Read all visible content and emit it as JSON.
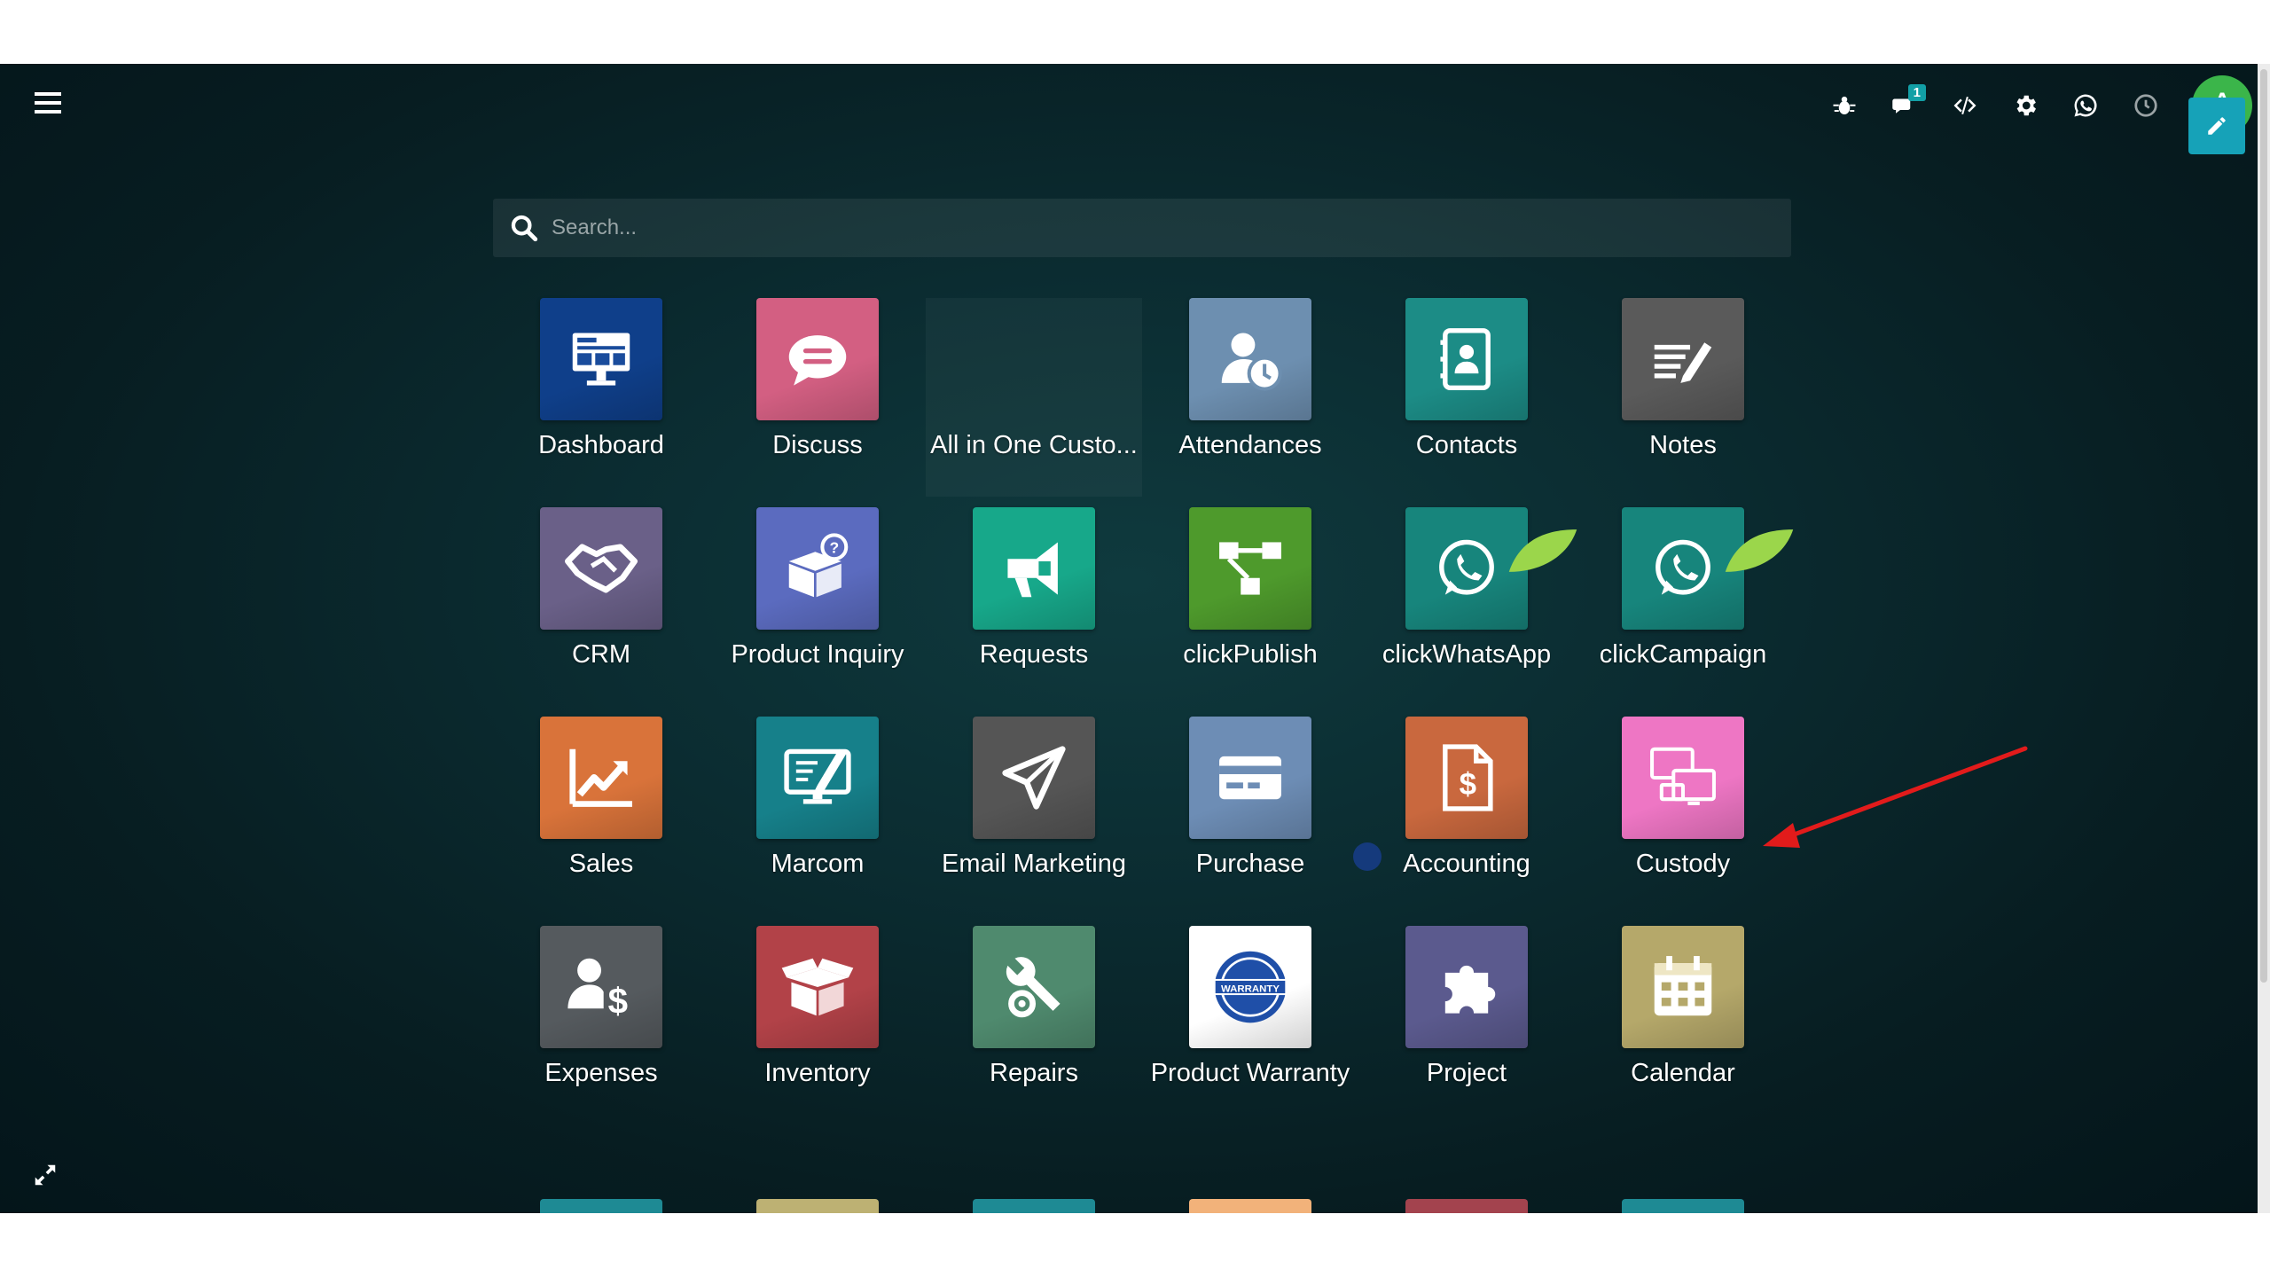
{
  "topbar": {
    "chat_badge": "1",
    "avatar_letter": "A"
  },
  "search": {
    "placeholder": "Search..."
  },
  "apps": [
    {
      "label": "Dashboard",
      "icon": "dashboard-icon",
      "color": "#0f3f8a"
    },
    {
      "label": "Discuss",
      "icon": "chat-bubble-icon",
      "color": "#d35f82"
    },
    {
      "label": "All in One Custo...",
      "icon": "",
      "color": ""
    },
    {
      "label": "Attendances",
      "icon": "user-clock-icon",
      "color": "#6d8fb0"
    },
    {
      "label": "Contacts",
      "icon": "address-book-icon",
      "color": "#1c8c86"
    },
    {
      "label": "Notes",
      "icon": "notes-pencil-icon",
      "color": "#5a5a5a"
    },
    {
      "label": "CRM",
      "icon": "handshake-icon",
      "color": "#6a6088"
    },
    {
      "label": "Product Inquiry",
      "icon": "box-question-icon",
      "color": "#5b6bbf"
    },
    {
      "label": "Requests",
      "icon": "megaphone-icon",
      "color": "#17a88a"
    },
    {
      "label": "clickPublish",
      "icon": "flow-nodes-icon",
      "color": "#4e9a2c"
    },
    {
      "label": "clickWhatsApp",
      "icon": "whatsapp-icon",
      "color": "#17857c"
    },
    {
      "label": "clickCampaign",
      "icon": "whatsapp-icon",
      "color": "#17857c"
    },
    {
      "label": "Sales",
      "icon": "trend-chart-icon",
      "color": "#d9733a"
    },
    {
      "label": "Marcom",
      "icon": "monitor-edit-icon",
      "color": "#16808a"
    },
    {
      "label": "Email Marketing",
      "icon": "paper-plane-icon",
      "color": "#555555"
    },
    {
      "label": "Purchase",
      "icon": "credit-card-icon",
      "color": "#6d8db5"
    },
    {
      "label": "Accounting",
      "icon": "invoice-dollar-icon",
      "color": "#c9683e"
    },
    {
      "label": "Custody",
      "icon": "devices-icon",
      "color": "#ee76c4"
    },
    {
      "label": "Expenses",
      "icon": "user-dollar-icon",
      "color": "#555a5e"
    },
    {
      "label": "Inventory",
      "icon": "open-box-icon",
      "color": "#b24248"
    },
    {
      "label": "Repairs",
      "icon": "wrench-gear-icon",
      "color": "#4f8a6e"
    },
    {
      "label": "Product Warranty",
      "icon": "warranty-seal-icon",
      "color": "#ffffff",
      "seal_text": "WARRANTY"
    },
    {
      "label": "Project",
      "icon": "puzzle-icon",
      "color": "#5b5a8e"
    },
    {
      "label": "Calendar",
      "icon": "calendar-icon",
      "color": "#b5a86a"
    }
  ],
  "partial_row_colors": [
    "#1e8a94",
    "#bdb173",
    "#1e8a94",
    "#f2b27a",
    "#a3434e",
    "#1e8a94"
  ],
  "colors": {
    "accent": "#16a2b8",
    "avatar": "#3bb54a",
    "annotation_arrow": "#e21b1b"
  }
}
